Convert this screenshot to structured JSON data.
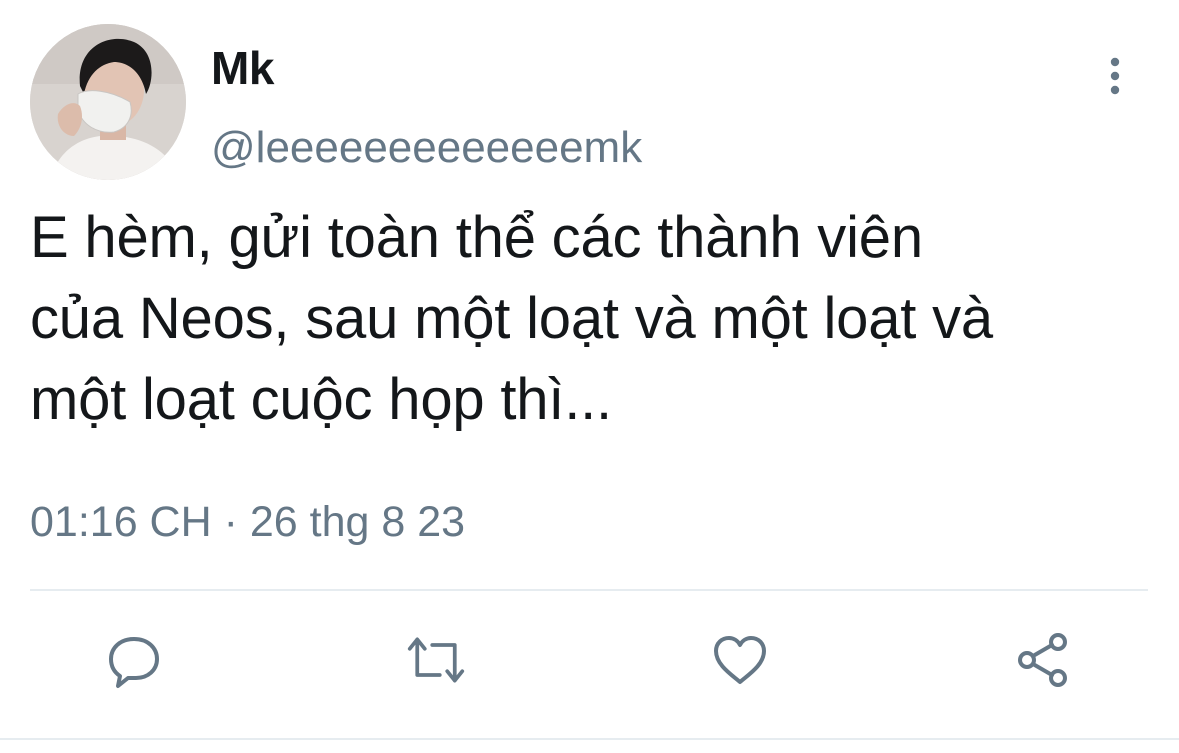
{
  "user": {
    "display_name": "Mk",
    "handle": "@leeeeeeeeeeeeemk",
    "avatar_icon": "avatar-photo"
  },
  "tweet": {
    "text_lines": [
      "E hèm, gửi toàn thể các thành viên",
      "của Neos, sau một loạt và một loạt và",
      "một loạt cuộc họp thì..."
    ],
    "timestamp": "01:16 CH · 26 thg 8 23"
  },
  "actions": [
    {
      "icon": "reply-icon"
    },
    {
      "icon": "retweet-icon"
    },
    {
      "icon": "like-icon"
    },
    {
      "icon": "share-icon"
    }
  ],
  "menu": {
    "icon": "more-vertical-icon"
  },
  "colors": {
    "text_primary": "#14171a",
    "text_secondary": "#657786",
    "divider": "#e6ecf0"
  }
}
